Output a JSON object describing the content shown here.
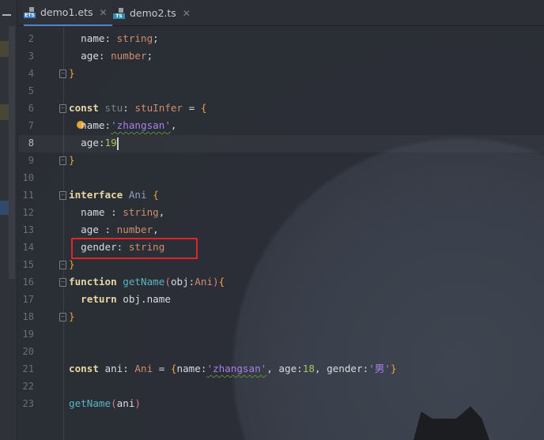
{
  "tabs": [
    {
      "label": "demo1.ets",
      "icon": "ets-file-icon",
      "badge": "ETS",
      "active": true
    },
    {
      "label": "demo2.ts",
      "icon": "ts-file-icon",
      "badge": "TS",
      "active": false
    }
  ],
  "colors": {
    "accent": "#4a88c7",
    "highlight_box": "#e0242a"
  },
  "editor": {
    "current_line": 8,
    "lines": [
      {
        "n": "2",
        "tokens": [
          [
            "  name",
            "id"
          ],
          [
            ": ",
            "id"
          ],
          [
            "string",
            "ty"
          ],
          [
            ";",
            "id"
          ]
        ]
      },
      {
        "n": "3",
        "tokens": [
          [
            "  age",
            "id"
          ],
          [
            ": ",
            "id"
          ],
          [
            "number",
            "ty"
          ],
          [
            ";",
            "id"
          ]
        ]
      },
      {
        "n": "4",
        "fold": true,
        "tokens": [
          [
            "}",
            "br"
          ]
        ]
      },
      {
        "n": "5",
        "tokens": []
      },
      {
        "n": "6",
        "fold": true,
        "tokens": [
          [
            "const",
            "kw"
          ],
          [
            " ",
            "id"
          ],
          [
            "stu",
            "dim"
          ],
          [
            ": ",
            "id"
          ],
          [
            "stuInfer",
            "ty"
          ],
          [
            " = ",
            "id"
          ],
          [
            "{",
            "br"
          ]
        ]
      },
      {
        "n": "7",
        "bulb": true,
        "tokens": [
          [
            "  name:",
            "id"
          ],
          [
            "'zhangsan'",
            "str wave"
          ],
          [
            ",",
            "id"
          ]
        ]
      },
      {
        "n": "8",
        "caret": true,
        "tokens": [
          [
            "  age:",
            "id"
          ],
          [
            "19",
            "num"
          ]
        ]
      },
      {
        "n": "9",
        "fold": true,
        "tokens": [
          [
            "}",
            "br"
          ]
        ]
      },
      {
        "n": "10",
        "tokens": []
      },
      {
        "n": "11",
        "fold": true,
        "tokens": [
          [
            "interface",
            "kw"
          ],
          [
            " ",
            "id"
          ],
          [
            "Ani",
            "iface"
          ],
          [
            " ",
            "id"
          ],
          [
            "{",
            "br"
          ]
        ]
      },
      {
        "n": "12",
        "tokens": [
          [
            "  name : ",
            "id"
          ],
          [
            "string",
            "ty"
          ],
          [
            ",",
            "id"
          ]
        ]
      },
      {
        "n": "13",
        "tokens": [
          [
            "  age : ",
            "id"
          ],
          [
            "number",
            "ty"
          ],
          [
            ",",
            "id"
          ]
        ]
      },
      {
        "n": "14",
        "tokens": [
          [
            "  gender: ",
            "id"
          ],
          [
            "string",
            "ty"
          ]
        ]
      },
      {
        "n": "15",
        "fold": true,
        "tokens": [
          [
            "}",
            "br"
          ]
        ]
      },
      {
        "n": "16",
        "fold": true,
        "tokens": [
          [
            "function",
            "kw"
          ],
          [
            " ",
            "id"
          ],
          [
            "getName",
            "fn"
          ],
          [
            "(",
            "pa"
          ],
          [
            "obj:",
            "id"
          ],
          [
            "Ani",
            "ty"
          ],
          [
            ")",
            "pa"
          ],
          [
            "{",
            "br"
          ]
        ]
      },
      {
        "n": "17",
        "tokens": [
          [
            "  ",
            "id"
          ],
          [
            "return",
            "kw"
          ],
          [
            " obj.name",
            "id"
          ]
        ]
      },
      {
        "n": "18",
        "fold": true,
        "tokens": [
          [
            "}",
            "br"
          ]
        ]
      },
      {
        "n": "19",
        "tokens": []
      },
      {
        "n": "20",
        "tokens": []
      },
      {
        "n": "21",
        "tokens": [
          [
            "const",
            "kw"
          ],
          [
            " ani: ",
            "id"
          ],
          [
            "Ani",
            "ty"
          ],
          [
            " = ",
            "id"
          ],
          [
            "{",
            "br"
          ],
          [
            "name:",
            "id"
          ],
          [
            "'zhangsan'",
            "str wave"
          ],
          [
            ", age:",
            "id"
          ],
          [
            "18",
            "num"
          ],
          [
            ", gender:",
            "id"
          ],
          [
            "'男'",
            "str"
          ],
          [
            "}",
            "br"
          ]
        ]
      },
      {
        "n": "22",
        "tokens": []
      },
      {
        "n": "23",
        "tokens": [
          [
            "getName",
            "fn"
          ],
          [
            "(",
            "pa"
          ],
          [
            "ani",
            "id"
          ],
          [
            ")",
            "pa"
          ]
        ]
      }
    ]
  }
}
